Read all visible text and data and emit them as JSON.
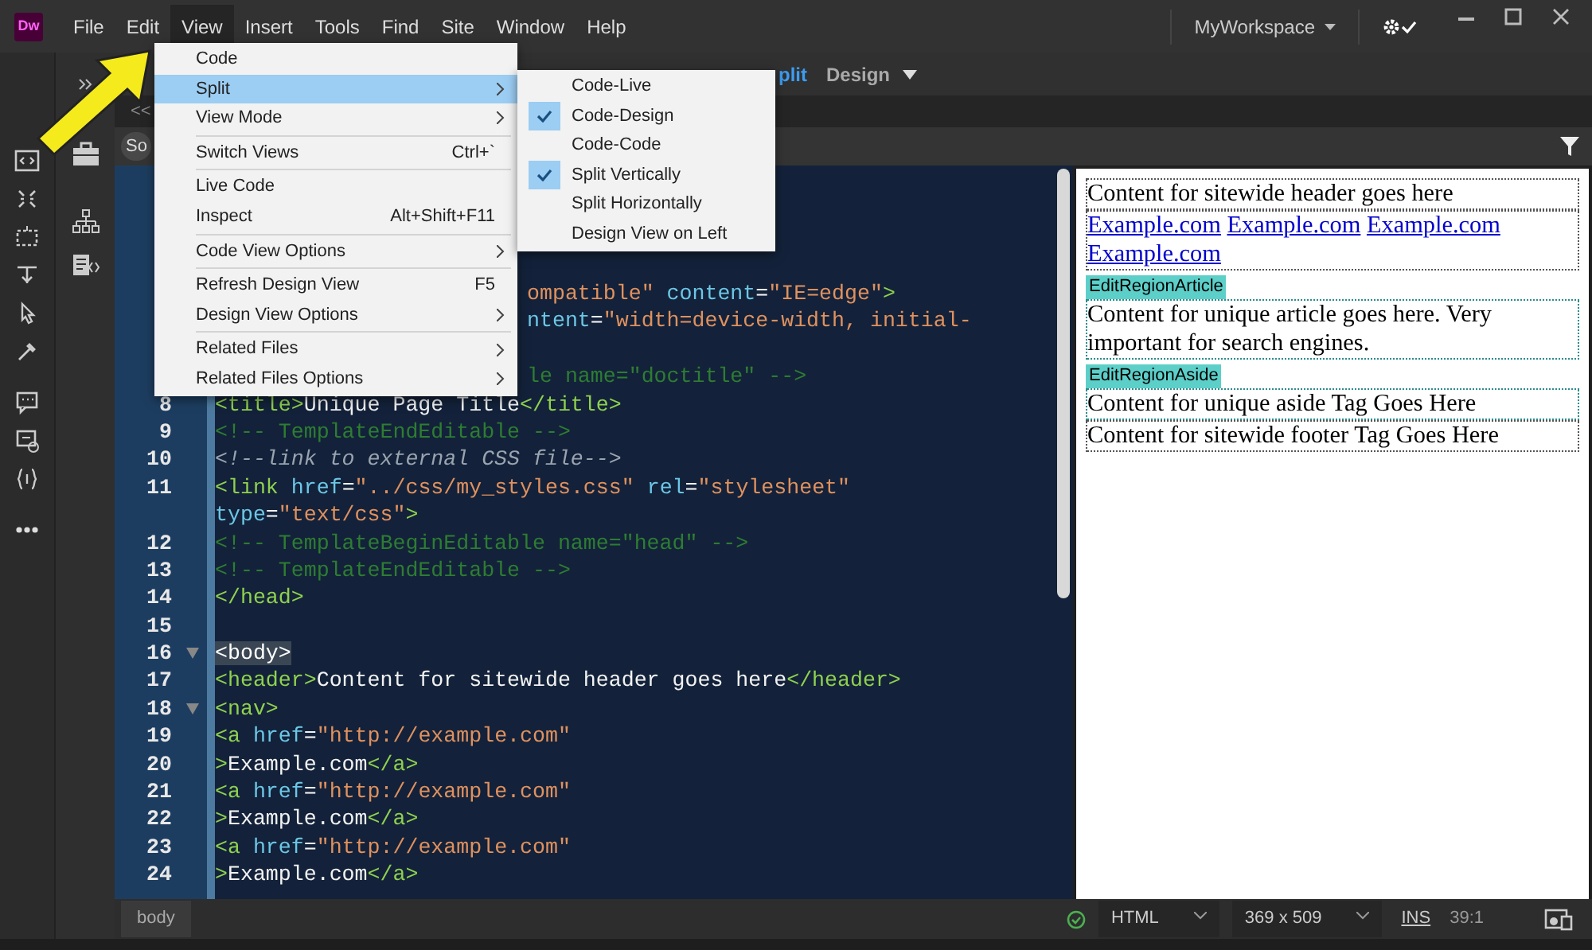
{
  "app": {
    "logo": "Dw"
  },
  "menubar": [
    {
      "label": "File",
      "selected": false
    },
    {
      "label": "Edit",
      "selected": false
    },
    {
      "label": "View",
      "selected": true
    },
    {
      "label": "Insert",
      "selected": false
    },
    {
      "label": "Tools",
      "selected": false
    },
    {
      "label": "Find",
      "selected": false
    },
    {
      "label": "Site",
      "selected": false
    },
    {
      "label": "Window",
      "selected": false
    },
    {
      "label": "Help",
      "selected": false
    }
  ],
  "workspace": {
    "label": "MyWorkspace"
  },
  "view_switcher": [
    {
      "label": "plit",
      "selected": true
    },
    {
      "label": "Design",
      "selected": false
    }
  ],
  "document_tab": {
    "label": "<<"
  },
  "panel_button": {
    "label": "So"
  },
  "view_menu": {
    "groups": [
      [
        {
          "label": "Code",
          "selected": false,
          "submenu": false
        },
        {
          "label": "Split",
          "selected": true,
          "submenu": true
        },
        {
          "label": "View Mode",
          "selected": false,
          "submenu": true
        }
      ],
      [
        {
          "label": "Switch Views",
          "shortcut": "Ctrl+`",
          "selected": false,
          "submenu": false
        }
      ],
      [
        {
          "label": "Live Code",
          "selected": false,
          "submenu": false
        },
        {
          "label": "Inspect",
          "shortcut": "Alt+Shift+F11",
          "selected": false,
          "submenu": false
        }
      ],
      [
        {
          "label": "Code View Options",
          "selected": false,
          "submenu": true
        }
      ],
      [
        {
          "label": "Refresh Design View",
          "shortcut": "F5",
          "selected": false,
          "submenu": false
        },
        {
          "label": "Design View Options",
          "selected": false,
          "submenu": true
        }
      ],
      [
        {
          "label": "Related Files",
          "selected": false,
          "submenu": true
        },
        {
          "label": "Related Files Options",
          "selected": false,
          "submenu": true
        }
      ]
    ]
  },
  "split_submenu": [
    {
      "label": "Code-Live",
      "checked": false
    },
    {
      "label": "Code-Design",
      "checked": true
    },
    {
      "label": "Code-Code",
      "checked": false
    },
    {
      "label": "Split Vertically",
      "checked": true
    },
    {
      "label": "Split Horizontally",
      "checked": false
    },
    {
      "label": "Design View on Left",
      "checked": false
    }
  ],
  "code": {
    "rows": [
      {
        "kind": "partial",
        "segments": [
          {
            "kind": "value",
            "text": "ompatible\""
          },
          {
            "kind": "attr",
            "text": " content"
          },
          {
            "kind": "plain",
            "text": "="
          },
          {
            "kind": "value",
            "text": "\"IE=edge\""
          },
          {
            "kind": "tag",
            "text": ">"
          }
        ]
      },
      {
        "kind": "partial",
        "segments": [
          {
            "kind": "attr",
            "text": "ntent"
          },
          {
            "kind": "plain",
            "text": "="
          },
          {
            "kind": "value",
            "text": "\"width=device-width, initial-"
          }
        ]
      },
      {
        "kind": "partial",
        "segments": []
      },
      {
        "kind": "partial",
        "segments": [
          {
            "kind": "comment",
            "text": "le name=\"doctitle\" -->"
          }
        ]
      },
      {
        "number": "8",
        "fold": false,
        "segments": [
          {
            "kind": "tag",
            "text": "<title>"
          },
          {
            "kind": "plain",
            "text": "Unique Page Title"
          },
          {
            "kind": "tag",
            "text": "</title>"
          }
        ]
      },
      {
        "number": "9",
        "fold": false,
        "segments": [
          {
            "kind": "comment",
            "text": "<!-- TemplateEndEditable -->"
          }
        ]
      },
      {
        "number": "10",
        "fold": false,
        "segments": [
          {
            "kind": "note",
            "text": "<!--link to external CSS file-->"
          }
        ]
      },
      {
        "number": "11",
        "fold": false,
        "segments": [
          {
            "kind": "tag",
            "text": "<link"
          },
          {
            "kind": "attr",
            "text": " href"
          },
          {
            "kind": "plain",
            "text": "="
          },
          {
            "kind": "value",
            "text": "\"../css/my_styles.css\""
          },
          {
            "kind": "attr",
            "text": " rel"
          },
          {
            "kind": "plain",
            "text": "="
          },
          {
            "kind": "value",
            "text": "\"stylesheet\""
          }
        ]
      },
      {
        "kind": "wrap",
        "segments": [
          {
            "kind": "attr",
            "text": "type"
          },
          {
            "kind": "plain",
            "text": "="
          },
          {
            "kind": "value",
            "text": "\"text/css\""
          },
          {
            "kind": "tag",
            "text": ">"
          }
        ]
      },
      {
        "number": "12",
        "fold": false,
        "segments": [
          {
            "kind": "comment",
            "text": "<!-- TemplateBeginEditable name=\"head\" -->"
          }
        ]
      },
      {
        "number": "13",
        "fold": false,
        "segments": [
          {
            "kind": "comment",
            "text": "<!-- TemplateEndEditable -->"
          }
        ]
      },
      {
        "number": "14",
        "fold": false,
        "segments": [
          {
            "kind": "tag",
            "text": "</head>"
          }
        ]
      },
      {
        "number": "15",
        "fold": false,
        "segments": []
      },
      {
        "number": "16",
        "fold": true,
        "segments": [
          {
            "kind": "match",
            "text": "<body>"
          }
        ]
      },
      {
        "number": "17",
        "fold": false,
        "segments": [
          {
            "kind": "tag",
            "text": "<header>"
          },
          {
            "kind": "plain",
            "text": "Content for sitewide header goes here"
          },
          {
            "kind": "tag",
            "text": "</header>"
          }
        ]
      },
      {
        "number": "18",
        "fold": true,
        "segments": [
          {
            "kind": "tag",
            "text": "<nav>"
          }
        ]
      },
      {
        "number": "19",
        "fold": false,
        "segments": [
          {
            "kind": "tag",
            "text": "<a"
          },
          {
            "kind": "attr",
            "text": " href"
          },
          {
            "kind": "plain",
            "text": "="
          },
          {
            "kind": "value",
            "text": "\"http://example.com\""
          }
        ]
      },
      {
        "number": "20",
        "fold": false,
        "segments": [
          {
            "kind": "tag",
            "text": ">"
          },
          {
            "kind": "plain",
            "text": "Example.com"
          },
          {
            "kind": "tag",
            "text": "</a>"
          }
        ]
      },
      {
        "number": "21",
        "fold": false,
        "segments": [
          {
            "kind": "tag",
            "text": "<a"
          },
          {
            "kind": "attr",
            "text": " href"
          },
          {
            "kind": "plain",
            "text": "="
          },
          {
            "kind": "value",
            "text": "\"http://example.com\""
          }
        ]
      },
      {
        "number": "22",
        "fold": false,
        "segments": [
          {
            "kind": "tag",
            "text": ">"
          },
          {
            "kind": "plain",
            "text": "Example.com"
          },
          {
            "kind": "tag",
            "text": "</a>"
          }
        ]
      },
      {
        "number": "23",
        "fold": false,
        "segments": [
          {
            "kind": "tag",
            "text": "<a"
          },
          {
            "kind": "attr",
            "text": " href"
          },
          {
            "kind": "plain",
            "text": "="
          },
          {
            "kind": "value",
            "text": "\"http://example.com\""
          }
        ]
      },
      {
        "number": "24",
        "fold": false,
        "segments": [
          {
            "kind": "tag",
            "text": ">"
          },
          {
            "kind": "plain",
            "text": "Example.com"
          },
          {
            "kind": "tag",
            "text": "</a>"
          }
        ]
      }
    ]
  },
  "live_view": {
    "blocks": [
      {
        "kind": "text",
        "text": "Content for sitewide header goes here"
      },
      {
        "kind": "links",
        "links": [
          "Example.com",
          "Example.com",
          "Example.com",
          "Example.com"
        ]
      },
      {
        "kind": "region",
        "label": "EditRegionArticle",
        "text": "Content for unique article goes here. Very important for search engines."
      },
      {
        "kind": "region",
        "label": "EditRegionAside",
        "text": "Content for unique aside Tag Goes Here"
      },
      {
        "kind": "text",
        "text": "Content for sitewide footer Tag Goes Here"
      }
    ]
  },
  "status_bar": {
    "tag": "body",
    "language": "HTML",
    "size": "369 x 509",
    "mode": "INS",
    "position": "39:1"
  }
}
